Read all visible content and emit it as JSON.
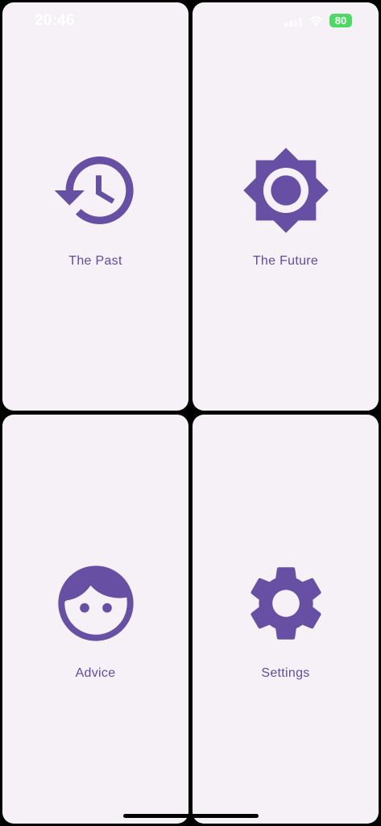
{
  "status_bar": {
    "time": "20:46",
    "battery": "80"
  },
  "tiles": [
    {
      "label": "The Past",
      "icon": "history-icon"
    },
    {
      "label": "The Future",
      "icon": "brightness-icon"
    },
    {
      "label": "Advice",
      "icon": "face-icon"
    },
    {
      "label": "Settings",
      "icon": "settings-gear-icon"
    }
  ],
  "colors": {
    "accent": "#6750a4",
    "tile_background": "#f6f1f7",
    "screen_background": "#000000",
    "battery": "#4cd964"
  }
}
